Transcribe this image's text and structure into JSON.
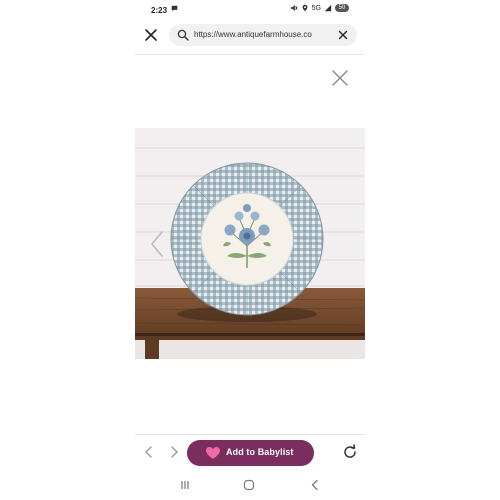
{
  "status_bar": {
    "time": "2:23",
    "network": "5G",
    "battery": "50",
    "icons": [
      "message-icon",
      "mute-icon",
      "location-icon",
      "signal-icon",
      "battery-icon"
    ]
  },
  "url_bar": {
    "url": "https://www.antiquefarmhouse.co",
    "icons": [
      "close-icon",
      "search-icon",
      "clear-icon"
    ]
  },
  "viewer": {
    "close_icon": "close-icon",
    "prev_icon": "chevron-left-icon",
    "image_subject": "round pillow"
  },
  "bottom_bar": {
    "back_icon": "chevron-left-icon",
    "forward_icon": "chevron-right-icon",
    "babylist_label": "Add to Babylist",
    "babylist_icon": "heart-icon",
    "reload_icon": "reload-icon"
  },
  "system_nav": {
    "icons": [
      "recents-icon",
      "home-icon",
      "back-icon"
    ]
  },
  "colors": {
    "babylist_button": "#7a2d5e",
    "heart": "#f06aa8",
    "url_pill": "#f1f1f4",
    "gingham": "#7d96a6"
  }
}
